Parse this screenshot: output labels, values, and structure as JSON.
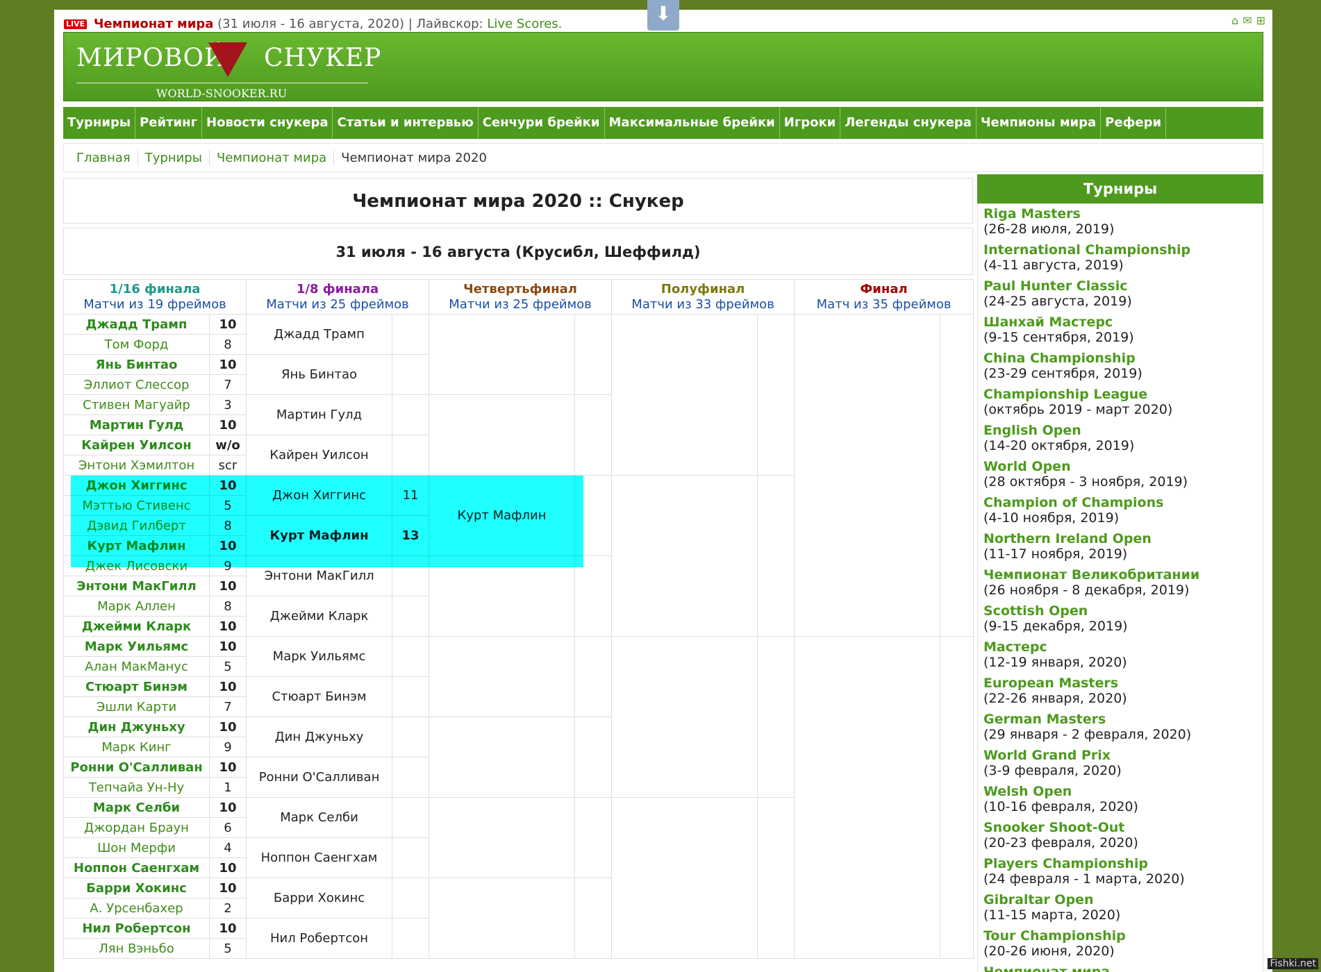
{
  "topbar": {
    "live_badge": "LIVE",
    "champ_link": "Чемпионат мира",
    "champ_dates": "(31 июля - 16 августа, 2020)",
    "separator": "| Лайвскор:",
    "live_scores": "Live Scores."
  },
  "logo": {
    "left_word": "МИРОВОЙ",
    "right_word": "СНУКЕР",
    "domain": "WORLD-SNOOKER.RU"
  },
  "nav": [
    "Турниры",
    "Рейтинг",
    "Новости снукера",
    "Статьи и интервью",
    "Сенчури брейки",
    "Максимальные брейки",
    "Игроки",
    "Легенды снукера",
    "Чемпионы мира",
    "Рефери"
  ],
  "breadcrumb": [
    "Главная",
    "Турниры",
    "Чемпионат мира",
    "Чемпионат мира 2020"
  ],
  "page_title": "Чемпионат мира 2020 :: Снукер",
  "event_dates": "31 июля - 16 августа (Крусибл, Шеффилд)",
  "rounds": [
    {
      "name": "1/16 финала",
      "sub": "Матчи из 19 фреймов",
      "color": "#1a9a8a"
    },
    {
      "name": "1/8 финала",
      "sub": "Матчи из 25 фреймов",
      "color": "#8b1aa3"
    },
    {
      "name": "Четвертьфинал",
      "sub": "Матчи из 25 фреймов",
      "color": "#8b4a14"
    },
    {
      "name": "Полуфинал",
      "sub": "Матчи из 33 фреймов",
      "color": "#7a7a10"
    },
    {
      "name": "Финал",
      "sub": "Матч из 35 фреймов",
      "color": "#a30000"
    }
  ],
  "round1": [
    {
      "p": "Джадд Трамп",
      "s": "10",
      "win": true
    },
    {
      "p": "Том Форд",
      "s": "8",
      "win": false
    },
    {
      "p": "Янь Бинтао",
      "s": "10",
      "win": true
    },
    {
      "p": "Эллиот Слессор",
      "s": "7",
      "win": false
    },
    {
      "p": "Стивен Магуайр",
      "s": "3",
      "win": false
    },
    {
      "p": "Мартин Гулд",
      "s": "10",
      "win": true
    },
    {
      "p": "Кайрен Уилсон",
      "s": "w/o",
      "win": true
    },
    {
      "p": "Энтони Хэмилтон",
      "s": "scr",
      "win": false
    },
    {
      "p": "Джон Хиггинс",
      "s": "10",
      "win": true
    },
    {
      "p": "Мэттью Стивенс",
      "s": "5",
      "win": false
    },
    {
      "p": "Дэвид Гилберт",
      "s": "8",
      "win": false
    },
    {
      "p": "Курт Мафлин",
      "s": "10",
      "win": true
    },
    {
      "p": "Джек Лисовски",
      "s": "9",
      "win": false
    },
    {
      "p": "Энтони МакГилл",
      "s": "10",
      "win": true
    },
    {
      "p": "Марк Аллен",
      "s": "8",
      "win": false
    },
    {
      "p": "Джейми Кларк",
      "s": "10",
      "win": true
    },
    {
      "p": "Марк Уильямс",
      "s": "10",
      "win": true
    },
    {
      "p": "Алан МакМанус",
      "s": "5",
      "win": false
    },
    {
      "p": "Стюарт Бинэм",
      "s": "10",
      "win": true
    },
    {
      "p": "Эшли Карти",
      "s": "7",
      "win": false
    },
    {
      "p": "Дин Джуньху",
      "s": "10",
      "win": true
    },
    {
      "p": "Марк Кинг",
      "s": "9",
      "win": false
    },
    {
      "p": "Ронни О'Салливан",
      "s": "10",
      "win": true
    },
    {
      "p": "Тепчайа Ун-Ну",
      "s": "1",
      "win": false
    },
    {
      "p": "Марк Селби",
      "s": "10",
      "win": true
    },
    {
      "p": "Джордан Браун",
      "s": "6",
      "win": false
    },
    {
      "p": "Шон Мерфи",
      "s": "4",
      "win": false
    },
    {
      "p": "Ноппон Саенгхам",
      "s": "10",
      "win": true
    },
    {
      "p": "Барри Хокинс",
      "s": "10",
      "win": true
    },
    {
      "p": "А. Урсенбахер",
      "s": "2",
      "win": false
    },
    {
      "p": "Нил Робертсон",
      "s": "10",
      "win": true
    },
    {
      "p": "Лян Вэньбо",
      "s": "5",
      "win": false
    }
  ],
  "round2": [
    {
      "p": "Джадд Трамп",
      "s": "",
      "win": false
    },
    {
      "p": "Янь Бинтао",
      "s": "",
      "win": false
    },
    {
      "p": "Мартин Гулд",
      "s": "",
      "win": false
    },
    {
      "p": "Кайрен Уилсон",
      "s": "",
      "win": false
    },
    {
      "p": "Джон Хиггинс",
      "s": "11",
      "win": false
    },
    {
      "p": "Курт Мафлин",
      "s": "13",
      "win": true
    },
    {
      "p": "Энтони МакГилл",
      "s": "",
      "win": false
    },
    {
      "p": "Джейми Кларк",
      "s": "",
      "win": false
    },
    {
      "p": "Марк Уильямс",
      "s": "",
      "win": false
    },
    {
      "p": "Стюарт Бинэм",
      "s": "",
      "win": false
    },
    {
      "p": "Дин Джуньху",
      "s": "",
      "win": false
    },
    {
      "p": "Ронни О'Салливан",
      "s": "",
      "win": false
    },
    {
      "p": "Марк Селби",
      "s": "",
      "win": false
    },
    {
      "p": "Ноппон Саенгхам",
      "s": "",
      "win": false
    },
    {
      "p": "Барри Хокинс",
      "s": "",
      "win": false
    },
    {
      "p": "Нил Робертсон",
      "s": "",
      "win": false
    }
  ],
  "quarterfinal": [
    "",
    "",
    "Курт Мафлин",
    "",
    "",
    "",
    "",
    ""
  ],
  "sidebar": {
    "title": "Турниры",
    "items": [
      {
        "name": "Riga Masters",
        "dates": "(26-28 июля, 2019)"
      },
      {
        "name": "International Championship",
        "dates": "(4-11 августа, 2019)"
      },
      {
        "name": "Paul Hunter Classic",
        "dates": "(24-25 августа, 2019)"
      },
      {
        "name": "Шанхай Мастерс",
        "dates": "(9-15 сентября, 2019)"
      },
      {
        "name": "China Championship",
        "dates": "(23-29 сентября, 2019)"
      },
      {
        "name": "Championship League",
        "dates": "(октябрь 2019 - март 2020)"
      },
      {
        "name": "English Open",
        "dates": "(14-20 октября, 2019)"
      },
      {
        "name": "World Open",
        "dates": "(28 октября - 3 ноября, 2019)"
      },
      {
        "name": "Champion of Champions",
        "dates": "(4-10 ноября, 2019)"
      },
      {
        "name": "Northern Ireland Open",
        "dates": "(11-17 ноября, 2019)"
      },
      {
        "name": "Чемпионат Великобритании",
        "dates": "(26 ноября - 8 декабря, 2019)"
      },
      {
        "name": "Scottish Open",
        "dates": "(9-15 декабря, 2019)"
      },
      {
        "name": "Мастерс",
        "dates": "(12-19 января, 2020)"
      },
      {
        "name": "European Masters",
        "dates": "(22-26 января, 2020)"
      },
      {
        "name": "German Masters",
        "dates": "(29 января - 2 февраля, 2020)"
      },
      {
        "name": "World Grand Prix",
        "dates": "(3-9 февраля, 2020)"
      },
      {
        "name": "Welsh Open",
        "dates": "(10-16 февраля, 2020)"
      },
      {
        "name": "Snooker Shoot-Out",
        "dates": "(20-23 февраля, 2020)"
      },
      {
        "name": "Players Championship",
        "dates": "(24 февраля - 1 марта, 2020)"
      },
      {
        "name": "Gibraltar Open",
        "dates": "(11-15 марта, 2020)"
      },
      {
        "name": "Tour Championship",
        "dates": "(20-26 июня, 2020)"
      },
      {
        "name": "Чемпионат мира",
        "dates": ""
      }
    ]
  },
  "watermark": "Fishki.net"
}
